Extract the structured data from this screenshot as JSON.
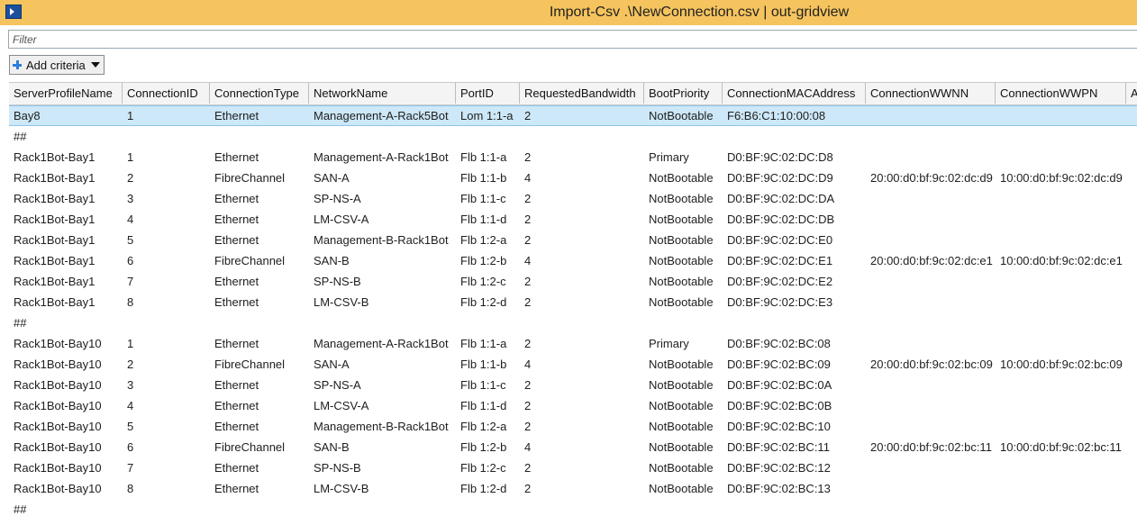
{
  "window": {
    "title": "Import-Csv .\\NewConnection.csv | out-gridview"
  },
  "filter": {
    "placeholder": "Filter"
  },
  "toolbar": {
    "add_criteria_label": "Add criteria"
  },
  "columns": [
    "ServerProfileName",
    "ConnectionID",
    "ConnectionType",
    "NetworkName",
    "PortID",
    "RequestedBandwidth",
    "BootPriority",
    "ConnectionMACAddress",
    "ConnectionWWNN",
    "ConnectionWWPN",
    "A"
  ],
  "rows": [
    [
      "Bay8",
      "1",
      "Ethernet",
      "Management-A-Rack5Bot",
      "Lom 1:1-a",
      "2",
      "NotBootable",
      "F6:B6:C1:10:00:08",
      "",
      ""
    ],
    [
      "##",
      "",
      "",
      "",
      "",
      "",
      "",
      "",
      "",
      ""
    ],
    [
      "Rack1Bot-Bay1",
      "1",
      "Ethernet",
      "Management-A-Rack1Bot",
      "Flb 1:1-a",
      "2",
      "Primary",
      "D0:BF:9C:02:DC:D8",
      "",
      ""
    ],
    [
      "Rack1Bot-Bay1",
      "2",
      "FibreChannel",
      "SAN-A",
      "Flb 1:1-b",
      "4",
      "NotBootable",
      "D0:BF:9C:02:DC:D9",
      "20:00:d0:bf:9c:02:dc:d9",
      "10:00:d0:bf:9c:02:dc:d9"
    ],
    [
      "Rack1Bot-Bay1",
      "3",
      "Ethernet",
      "SP-NS-A",
      "Flb 1:1-c",
      "2",
      "NotBootable",
      "D0:BF:9C:02:DC:DA",
      "",
      ""
    ],
    [
      "Rack1Bot-Bay1",
      "4",
      "Ethernet",
      "LM-CSV-A",
      "Flb 1:1-d",
      "2",
      "NotBootable",
      "D0:BF:9C:02:DC:DB",
      "",
      ""
    ],
    [
      "Rack1Bot-Bay1",
      "5",
      "Ethernet",
      "Management-B-Rack1Bot",
      "Flb 1:2-a",
      "2",
      "NotBootable",
      "D0:BF:9C:02:DC:E0",
      "",
      ""
    ],
    [
      "Rack1Bot-Bay1",
      "6",
      "FibreChannel",
      "SAN-B",
      "Flb 1:2-b",
      "4",
      "NotBootable",
      "D0:BF:9C:02:DC:E1",
      "20:00:d0:bf:9c:02:dc:e1",
      "10:00:d0:bf:9c:02:dc:e1"
    ],
    [
      "Rack1Bot-Bay1",
      "7",
      "Ethernet",
      "SP-NS-B",
      "Flb 1:2-c",
      "2",
      "NotBootable",
      "D0:BF:9C:02:DC:E2",
      "",
      ""
    ],
    [
      "Rack1Bot-Bay1",
      "8",
      "Ethernet",
      "LM-CSV-B",
      "Flb 1:2-d",
      "2",
      "NotBootable",
      "D0:BF:9C:02:DC:E3",
      "",
      ""
    ],
    [
      "##",
      "",
      "",
      "",
      "",
      "",
      "",
      "",
      "",
      ""
    ],
    [
      "Rack1Bot-Bay10",
      "1",
      "Ethernet",
      "Management-A-Rack1Bot",
      "Flb 1:1-a",
      "2",
      "Primary",
      "D0:BF:9C:02:BC:08",
      "",
      ""
    ],
    [
      "Rack1Bot-Bay10",
      "2",
      "FibreChannel",
      "SAN-A",
      "Flb 1:1-b",
      "4",
      "NotBootable",
      "D0:BF:9C:02:BC:09",
      "20:00:d0:bf:9c:02:bc:09",
      "10:00:d0:bf:9c:02:bc:09"
    ],
    [
      "Rack1Bot-Bay10",
      "3",
      "Ethernet",
      "SP-NS-A",
      "Flb 1:1-c",
      "2",
      "NotBootable",
      "D0:BF:9C:02:BC:0A",
      "",
      ""
    ],
    [
      "Rack1Bot-Bay10",
      "4",
      "Ethernet",
      "LM-CSV-A",
      "Flb 1:1-d",
      "2",
      "NotBootable",
      "D0:BF:9C:02:BC:0B",
      "",
      ""
    ],
    [
      "Rack1Bot-Bay10",
      "5",
      "Ethernet",
      "Management-B-Rack1Bot",
      "Flb 1:2-a",
      "2",
      "NotBootable",
      "D0:BF:9C:02:BC:10",
      "",
      ""
    ],
    [
      "Rack1Bot-Bay10",
      "6",
      "FibreChannel",
      "SAN-B",
      "Flb 1:2-b",
      "4",
      "NotBootable",
      "D0:BF:9C:02:BC:11",
      "20:00:d0:bf:9c:02:bc:11",
      "10:00:d0:bf:9c:02:bc:11"
    ],
    [
      "Rack1Bot-Bay10",
      "7",
      "Ethernet",
      "SP-NS-B",
      "Flb 1:2-c",
      "2",
      "NotBootable",
      "D0:BF:9C:02:BC:12",
      "",
      ""
    ],
    [
      "Rack1Bot-Bay10",
      "8",
      "Ethernet",
      "LM-CSV-B",
      "Flb 1:2-d",
      "2",
      "NotBootable",
      "D0:BF:9C:02:BC:13",
      "",
      ""
    ],
    [
      "##",
      "",
      "",
      "",
      "",
      "",
      "",
      "",
      "",
      ""
    ]
  ],
  "selected_row": 0,
  "colors": {
    "titlebar": "#f5c45e",
    "selection": "#cde8f8",
    "accent": "#2f7fd6"
  }
}
